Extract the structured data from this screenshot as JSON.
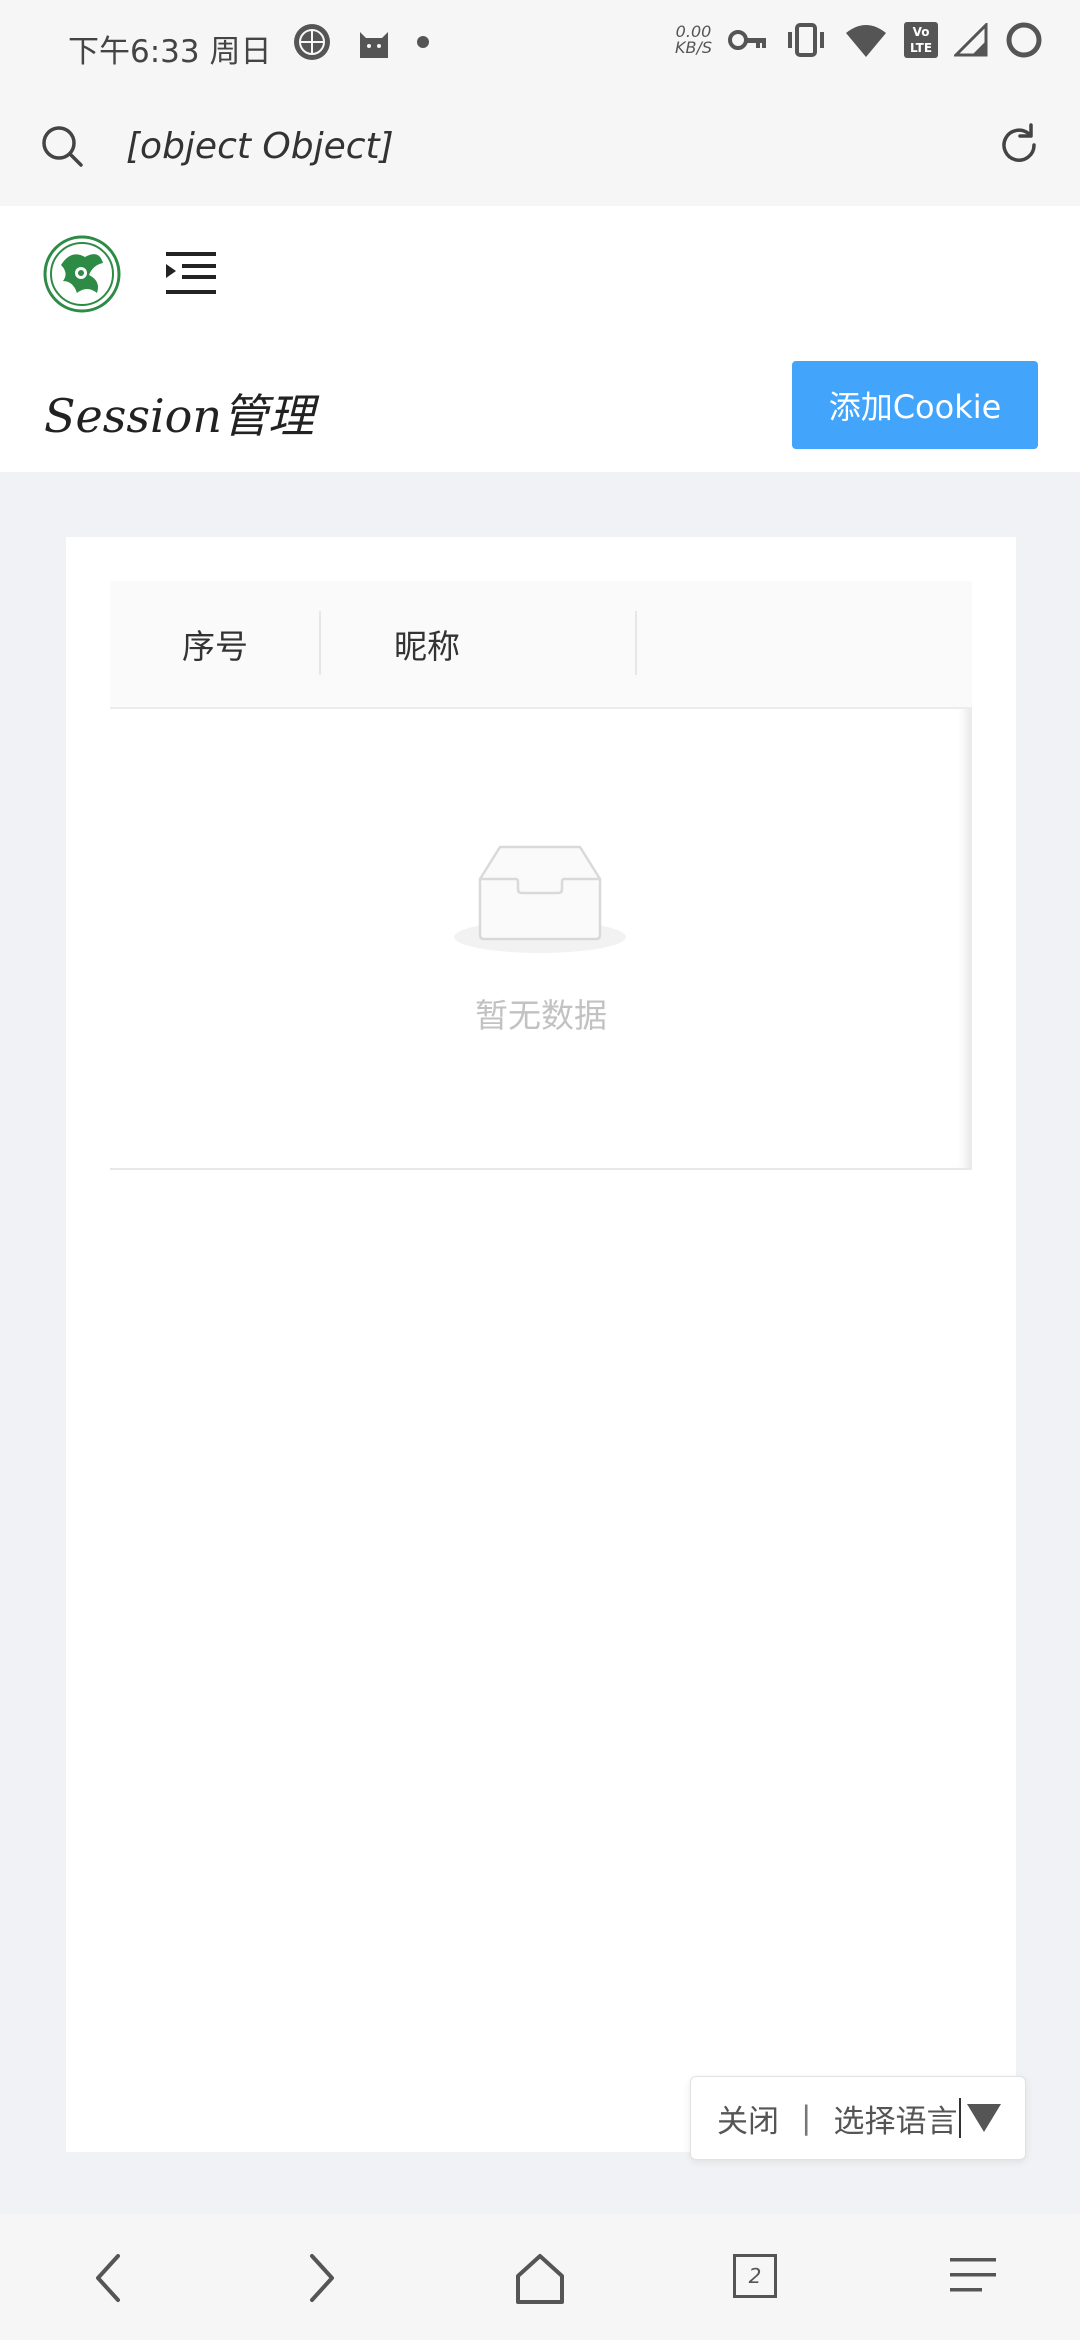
{
  "status_bar": {
    "time": "下午6:33 周日",
    "net_speed_value": "0.00",
    "net_speed_unit": "KB/S",
    "volte_top": "Vo",
    "volte_bottom": "LTE"
  },
  "url_bar": {
    "url_text": "[object Object]"
  },
  "page": {
    "title": "Session管理",
    "add_cookie_label": "添加Cookie"
  },
  "table": {
    "columns": [
      "序号",
      "昵称"
    ],
    "empty_text": "暂无数据"
  },
  "language_popup": {
    "close_label": "关闭",
    "separator": "|",
    "select_label": "选择语言"
  },
  "bottom_nav": {
    "tab_count": "2"
  },
  "colors": {
    "accent": "#42a5fb",
    "background": "#f0f2f5",
    "logo_green": "#2e8b46"
  }
}
